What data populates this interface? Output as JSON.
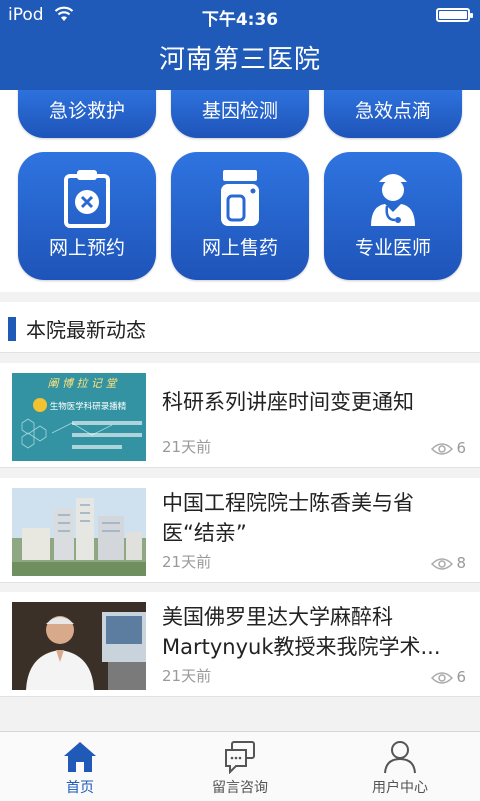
{
  "status": {
    "carrier": "iPod",
    "time": "下午4:36"
  },
  "header": {
    "title": "河南第三医院"
  },
  "top_row": [
    "急诊救护",
    "基因检测",
    "急效点滴"
  ],
  "services": [
    "网上预约",
    "网上售药",
    "专业医师"
  ],
  "section": {
    "title": "本院最新动态"
  },
  "news": [
    {
      "title": "科研系列讲座时间变更通知",
      "ago": "21天前",
      "views": "6",
      "thumb_text": "生物医学科研录播精",
      "thumb_calligraphy": "阐 博 拉 记 堂"
    },
    {
      "title": "中国工程院院士陈香美与省医“结亲”",
      "ago": "21天前",
      "views": "8"
    },
    {
      "title": "美国佛罗里达大学麻醉科Martynyuk教授来我院学术...",
      "ago": "21天前",
      "views": "6"
    }
  ],
  "tabs": [
    {
      "label": "首页",
      "icon": "home-icon",
      "active": true
    },
    {
      "label": "留言咨询",
      "icon": "chat-icon",
      "active": false
    },
    {
      "label": "用户中心",
      "icon": "user-icon",
      "active": false
    }
  ],
  "colors": {
    "brand": "#1f5ab8",
    "tile_top": "#2f74e0",
    "tile_bottom": "#1e54b9"
  }
}
